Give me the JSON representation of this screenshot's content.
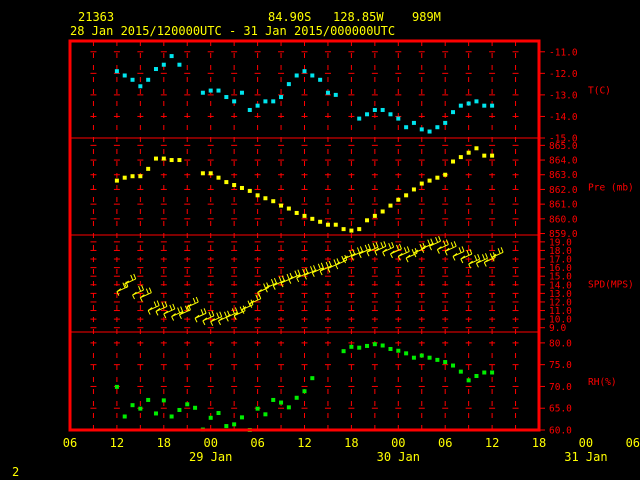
{
  "header": {
    "station": "21363",
    "location": "84.90S   128.85W",
    "elevation": "989M",
    "period": "28 Jan 2015/120000UTC - 31 Jan 2015/000000UTC"
  },
  "footer": {
    "page_number": "2"
  },
  "colors": {
    "background": "#000000",
    "frame": "#ff0000",
    "text": "#ffff00",
    "temperature": "#00e5ee",
    "pressure": "#ffff00",
    "wind": "#ffff00",
    "humidity": "#00ee00"
  },
  "chart_data": {
    "type": "multi-panel time series",
    "x_axis": {
      "range_hours": [
        -6,
        54
      ],
      "tick_labels": [
        "06",
        "12",
        "18",
        "00",
        "06",
        "12",
        "18",
        "00",
        "06",
        "12",
        "18",
        "00",
        "06"
      ],
      "date_labels": [
        {
          "hour": 12,
          "label": "29 Jan"
        },
        {
          "hour": 36,
          "label": "30 Jan"
        },
        {
          "hour": 60,
          "label": "31 Jan"
        }
      ],
      "grid": true
    },
    "panels": [
      {
        "id": "temperature",
        "label": "T(C)",
        "type": "scatter",
        "ylim": [
          -15.0,
          -10.5
        ],
        "ticks": [
          -11.0,
          -12.0,
          -13.0,
          -14.0,
          -15.0
        ],
        "tick_labels": [
          "-11.0",
          "-12.0",
          "-13.0",
          "-14.0",
          "-15.0"
        ],
        "x": [
          0,
          1,
          2,
          3,
          4,
          5,
          6,
          7,
          8,
          9,
          10,
          11,
          12,
          13,
          14,
          15,
          16,
          17,
          18,
          19,
          20,
          21,
          22,
          23,
          24,
          25,
          26,
          27,
          28,
          29,
          30,
          31,
          32,
          33,
          34,
          35,
          36,
          37,
          38,
          39,
          40,
          41,
          42,
          43,
          44,
          45,
          46,
          47,
          48
        ],
        "y": [
          -11.9,
          -12.1,
          -12.3,
          -12.6,
          -12.3,
          -11.8,
          -11.6,
          -11.2,
          -11.6,
          null,
          null,
          -12.9,
          -12.8,
          -12.8,
          -13.1,
          -13.3,
          -12.9,
          -13.7,
          -13.5,
          -13.3,
          -13.3,
          -13.1,
          -12.5,
          -12.1,
          -11.9,
          -12.1,
          -12.3,
          -12.9,
          -13.0,
          null,
          null,
          -14.1,
          -13.9,
          -13.7,
          -13.7,
          -13.9,
          -14.1,
          -14.5,
          -14.3,
          -14.6,
          -14.7,
          -14.5,
          -14.3,
          -13.8,
          -13.5,
          -13.4,
          -13.3,
          -13.5,
          -13.5
        ]
      },
      {
        "id": "pressure",
        "label": "Pre (mb)",
        "type": "scatter",
        "ylim": [
          858.9,
          865.5
        ],
        "ticks": [
          865.0,
          864.0,
          863.0,
          862.0,
          861.0,
          860.0,
          859.0
        ],
        "tick_labels": [
          "865.0",
          "864.0",
          "863.0",
          "862.0",
          "861.0",
          "860.0",
          "859.0"
        ],
        "x": [
          0,
          1,
          2,
          3,
          4,
          5,
          6,
          7,
          8,
          9,
          10,
          11,
          12,
          13,
          14,
          15,
          16,
          17,
          18,
          19,
          20,
          21,
          22,
          23,
          24,
          25,
          26,
          27,
          28,
          29,
          30,
          31,
          32,
          33,
          34,
          35,
          36,
          37,
          38,
          39,
          40,
          41,
          42,
          43,
          44,
          45,
          46,
          47,
          48
        ],
        "y": [
          862.6,
          862.8,
          862.9,
          862.9,
          863.4,
          864.1,
          864.1,
          864.0,
          864.0,
          null,
          null,
          863.1,
          863.1,
          862.8,
          862.5,
          862.3,
          862.1,
          861.9,
          861.6,
          861.4,
          861.2,
          860.9,
          860.7,
          860.4,
          860.2,
          860.0,
          859.8,
          859.6,
          859.6,
          859.3,
          859.2,
          859.3,
          859.9,
          860.2,
          860.5,
          860.9,
          861.3,
          861.6,
          862.0,
          862.4,
          862.6,
          862.8,
          863.0,
          863.9,
          864.2,
          864.5,
          864.8,
          864.3,
          864.3
        ]
      },
      {
        "id": "wind_speed",
        "label": "SPD(MPS)",
        "type": "wind barbs",
        "ylim": [
          8.5,
          19.8
        ],
        "ticks": [
          19.0,
          18.0,
          17.0,
          16.0,
          15.0,
          14.0,
          13.0,
          12.0,
          11.0,
          10.0,
          9.0
        ],
        "tick_labels": [
          "19.0",
          "18.0",
          "17.0",
          "16.0",
          "15.0",
          "14.0",
          "13.0",
          "12.0",
          "11.0",
          "10.0",
          "9.0"
        ],
        "x": [
          0,
          1,
          2,
          3,
          4,
          5,
          6,
          7,
          8,
          9,
          10,
          11,
          12,
          13,
          14,
          15,
          16,
          17,
          18,
          19,
          20,
          21,
          22,
          23,
          24,
          25,
          26,
          27,
          28,
          29,
          30,
          31,
          32,
          33,
          34,
          35,
          36,
          37,
          38,
          39,
          40,
          41,
          42,
          43,
          44,
          45,
          46,
          47,
          48
        ],
        "y": [
          13.2,
          14.1,
          12.8,
          12.5,
          11.0,
          10.9,
          10.6,
          10.3,
          10.5,
          11.4,
          10.1,
          9.8,
          9.7,
          9.8,
          10.2,
          10.4,
          11.1,
          11.8,
          13.1,
          13.6,
          13.9,
          14.2,
          14.6,
          14.8,
          15.1,
          15.4,
          15.6,
          15.9,
          16.3,
          17.0,
          17.3,
          17.6,
          17.8,
          17.9,
          17.8,
          17.6,
          17.3,
          17.1,
          17.7,
          18.2,
          18.5,
          18.1,
          17.9,
          17.3,
          17.0,
          16.4,
          16.5,
          16.6,
          17.2
        ]
      },
      {
        "id": "relative_humidity",
        "label": "RH(%)",
        "type": "scatter",
        "ylim": [
          60.0,
          82.5
        ],
        "ticks": [
          80.0,
          75.0,
          70.0,
          65.0,
          60.0
        ],
        "tick_labels": [
          "80.0",
          "75.0",
          "70.0",
          "65.0",
          "60.0"
        ],
        "x": [
          0,
          1,
          2,
          3,
          4,
          5,
          6,
          7,
          8,
          9,
          10,
          11,
          12,
          13,
          14,
          15,
          16,
          17,
          18,
          19,
          20,
          21,
          22,
          23,
          24,
          25,
          26,
          27,
          28,
          29,
          30,
          31,
          32,
          33,
          34,
          35,
          36,
          37,
          38,
          39,
          40,
          41,
          42,
          43,
          44,
          45,
          46,
          47,
          48
        ],
        "y": [
          69.9,
          63.1,
          65.7,
          64.9,
          66.9,
          63.8,
          66.8,
          63.1,
          64.6,
          65.9,
          65.1,
          60.1,
          62.8,
          63.9,
          60.9,
          61.3,
          62.9,
          60.0,
          64.9,
          63.6,
          66.9,
          66.3,
          65.2,
          67.4,
          68.9,
          71.9,
          null,
          null,
          null,
          78.1,
          79.1,
          78.9,
          79.3,
          79.7,
          79.4,
          78.6,
          78.2,
          77.6,
          76.6,
          77.1,
          76.6,
          76.1,
          75.6,
          74.8,
          73.4,
          71.4,
          72.4,
          73.2,
          73.2
        ]
      }
    ]
  }
}
